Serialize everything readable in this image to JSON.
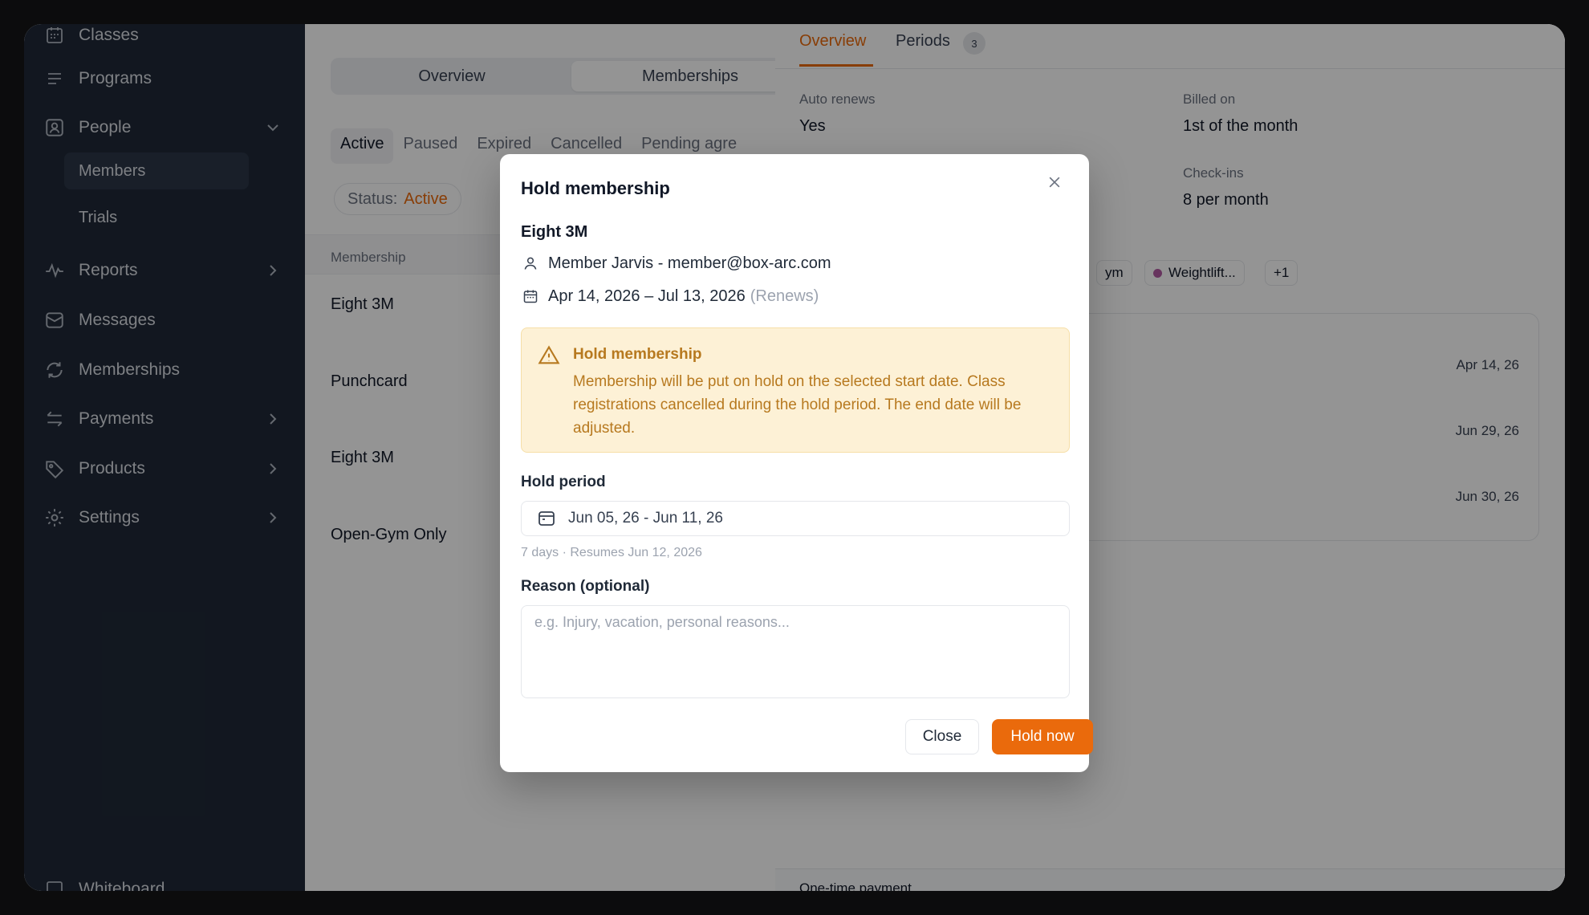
{
  "colors": {
    "accent": "#ea6a0c",
    "sidebar_bg": "#1f2937",
    "warning_bg": "#fdf1d6",
    "warning_text": "#b7791f"
  },
  "sidebar": {
    "items": [
      {
        "label": "Classes",
        "icon": "calendar-grid-icon"
      },
      {
        "label": "Programs",
        "icon": "list-lines-icon"
      },
      {
        "label": "People",
        "icon": "person-badge-icon"
      },
      {
        "label": "Members"
      },
      {
        "label": "Trials"
      },
      {
        "label": "Reports",
        "icon": "activity-icon"
      },
      {
        "label": "Messages",
        "icon": "envelope-icon"
      },
      {
        "label": "Memberships",
        "icon": "refresh-icon"
      },
      {
        "label": "Payments",
        "icon": "transfer-arrows-icon"
      },
      {
        "label": "Products",
        "icon": "tag-icon"
      },
      {
        "label": "Settings",
        "icon": "gear-icon"
      },
      {
        "label": "Whiteboard",
        "icon": "whiteboard-icon"
      }
    ]
  },
  "middle": {
    "segments": [
      "Overview",
      "Memberships"
    ],
    "filters": [
      "Active",
      "Paused",
      "Expired",
      "Cancelled",
      "Pending agre"
    ],
    "status_label": "Status:",
    "status_value": "Active",
    "column_header": "Membership",
    "rows": [
      "Eight 3M",
      "Punchcard",
      "Eight 3M",
      "Open-Gym Only"
    ]
  },
  "right": {
    "tabs": {
      "overview": "Overview",
      "periods": "Periods",
      "periods_count": "3"
    },
    "auto_renews_label": "Auto renews",
    "auto_renews_value": "Yes",
    "billed_on_label": "Billed on",
    "billed_on_value": "1st of the month",
    "checkins_label": "Check-ins",
    "checkins_value": "8 per month",
    "chips": [
      "ym",
      "Weightlift...",
      "+1"
    ],
    "period_dates": [
      "Apr 14, 26",
      "Jun 29, 26",
      "Jun 30, 26"
    ],
    "bottom_label": "One-time payment"
  },
  "modal": {
    "title": "Hold membership",
    "membership_name": "Eight 3M",
    "member_line": "Member Jarvis - member@box-arc.com",
    "dates": "Apr 14, 2026 – Jul 13, 2026",
    "renews": "(Renews)",
    "alert_title": "Hold membership",
    "alert_body": "Membership will be put on hold on the selected start date. Class registrations cancelled during the hold period. The end date will be adjusted.",
    "hold_period_label": "Hold period",
    "hold_period_value": "Jun 05, 26 - Jun 11, 26",
    "hold_hint": "7 days · Resumes Jun 12, 2026",
    "reason_label": "Reason (optional)",
    "reason_placeholder": "e.g. Injury, vacation, personal reasons...",
    "close_label": "Close",
    "hold_label": "Hold now"
  }
}
